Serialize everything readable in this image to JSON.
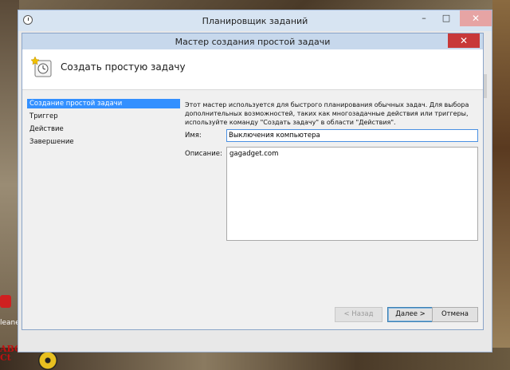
{
  "parent_window": {
    "title": "Планировщик заданий",
    "minimize": "–",
    "maximize": "□",
    "close": "✕"
  },
  "dialog": {
    "title": "Мастер создания простой задачи",
    "close": "✕",
    "header_title": "Создать простую задачу",
    "nav_items": [
      {
        "label": "Создание простой задачи",
        "selected": true
      },
      {
        "label": "Триггер",
        "selected": false
      },
      {
        "label": "Действие",
        "selected": false
      },
      {
        "label": "Завершение",
        "selected": false
      }
    ],
    "intro_text": "Этот мастер используется для быстрого планирования обычных задач.  Для выбора дополнительных возможностей, таких как многозадачные действия или триггеры, используйте команду \"Создать задачу\" в области \"Действия\".",
    "name_label": "Имя:",
    "name_value": "Выключения компьютера",
    "description_label": "Описание:",
    "description_value": "gagadget.com",
    "buttons": {
      "back": "< Назад",
      "next": "Далее >",
      "cancel": "Отмена"
    }
  },
  "desktop": {
    "abc_icon_text": [
      "ABC",
      "Ct"
    ],
    "lean_label": "leane"
  },
  "colors": {
    "selection": "#3390ff",
    "dialog_close": "#c83838",
    "input_focus_border": "#4a90e2"
  }
}
